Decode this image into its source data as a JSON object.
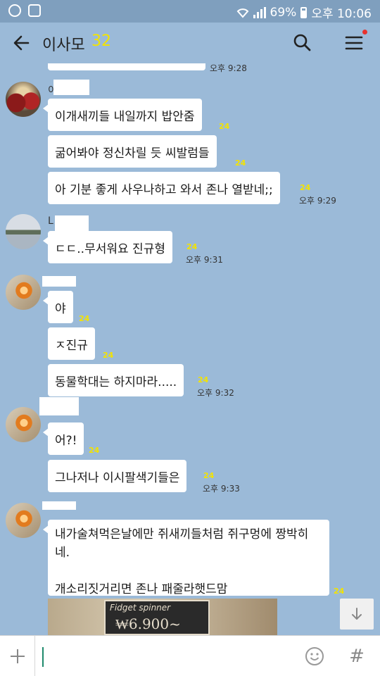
{
  "status_bar": {
    "battery": "69%",
    "time": "오후 10:06"
  },
  "header": {
    "title": "이사모",
    "member_count": "32"
  },
  "messages": [
    {
      "text": "",
      "time": "오후 9:28"
    },
    {
      "sender_initial": "이",
      "text": "이개새끼들 내일까지 밥안줌",
      "unread": "24"
    },
    {
      "text": "굶어봐야 정신차릴 듯 씨발럼들",
      "unread": "24"
    },
    {
      "text": "아 기분 좋게 사우나하고 와서 존나 열받네;;",
      "unread": "24",
      "time": "오후 9:29"
    },
    {
      "sender_initial": "L",
      "text": "ㄷㄷ..무서워요 진규형",
      "unread": "24",
      "time": "오후 9:31"
    },
    {
      "text": "야",
      "unread": "24"
    },
    {
      "text": "ㅈ진규",
      "unread": "24"
    },
    {
      "text": "동물학대는 하지마라.....",
      "unread": "24",
      "time": "오후 9:32"
    },
    {
      "text": "어?!",
      "unread": "24"
    },
    {
      "text": "그나저나 이시팔색기들은",
      "unread": "24",
      "time": "오후 9:33"
    },
    {
      "text": "내가술쳐먹은날에만 쥐새끼들처럼 쥐구멍에 짱박히네.\n\n개소리짓거리면 존나 패줄라햇드맘",
      "unread": "24"
    }
  ],
  "photo": {
    "sign_text": "Fidget spinner",
    "price": "₩6.900~"
  },
  "input": {
    "placeholder": ""
  },
  "colors": {
    "chat_background": "#9bbad8",
    "unread_count": "#f3e300",
    "notification_dot": "#e8322d"
  }
}
